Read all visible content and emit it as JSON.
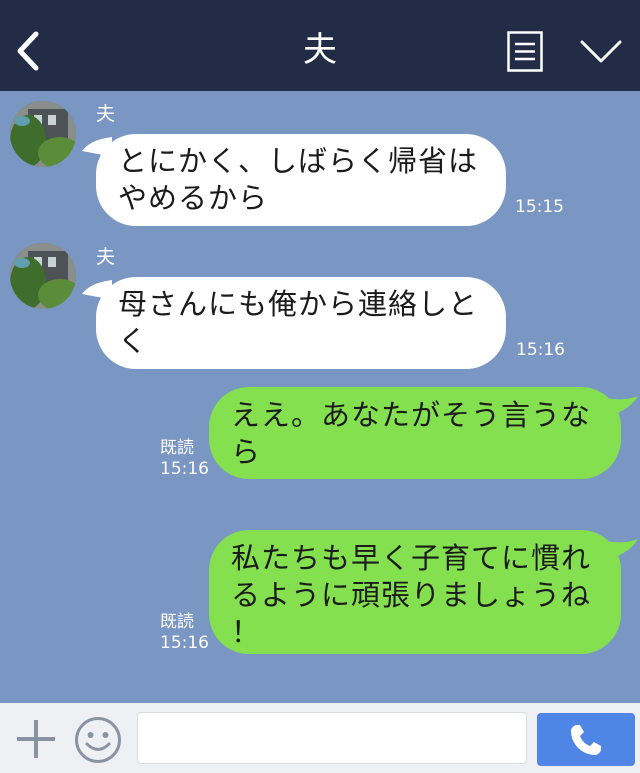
{
  "header": {
    "title": "夫"
  },
  "messages": [
    {
      "sender": "夫",
      "lines": [
        "とにかく、しばらく帰省は",
        "やめるから"
      ],
      "time": "15:15"
    },
    {
      "sender": "夫",
      "lines": [
        "母さんにも俺から連絡しと",
        "く"
      ],
      "time": "15:16"
    },
    {
      "lines": [
        "ええ。あなたがそう言うな",
        "ら"
      ],
      "read": "既読",
      "time": "15:16"
    },
    {
      "lines": [
        "私たちも早く子育てに慣れ",
        "るように頑張りましょうね",
        "！"
      ],
      "read": "既読",
      "time": "15:16"
    }
  ],
  "input": {
    "placeholder": ""
  },
  "colors": {
    "header": "#232c46",
    "background": "#7a96c3",
    "outgoing_bubble": "#84e04f",
    "incoming_bubble": "#ffffff",
    "call_button": "#4f86e6"
  },
  "icons": [
    "back-icon",
    "menu-icon",
    "chevron-down-icon",
    "plus-icon",
    "smile-icon",
    "phone-icon"
  ]
}
